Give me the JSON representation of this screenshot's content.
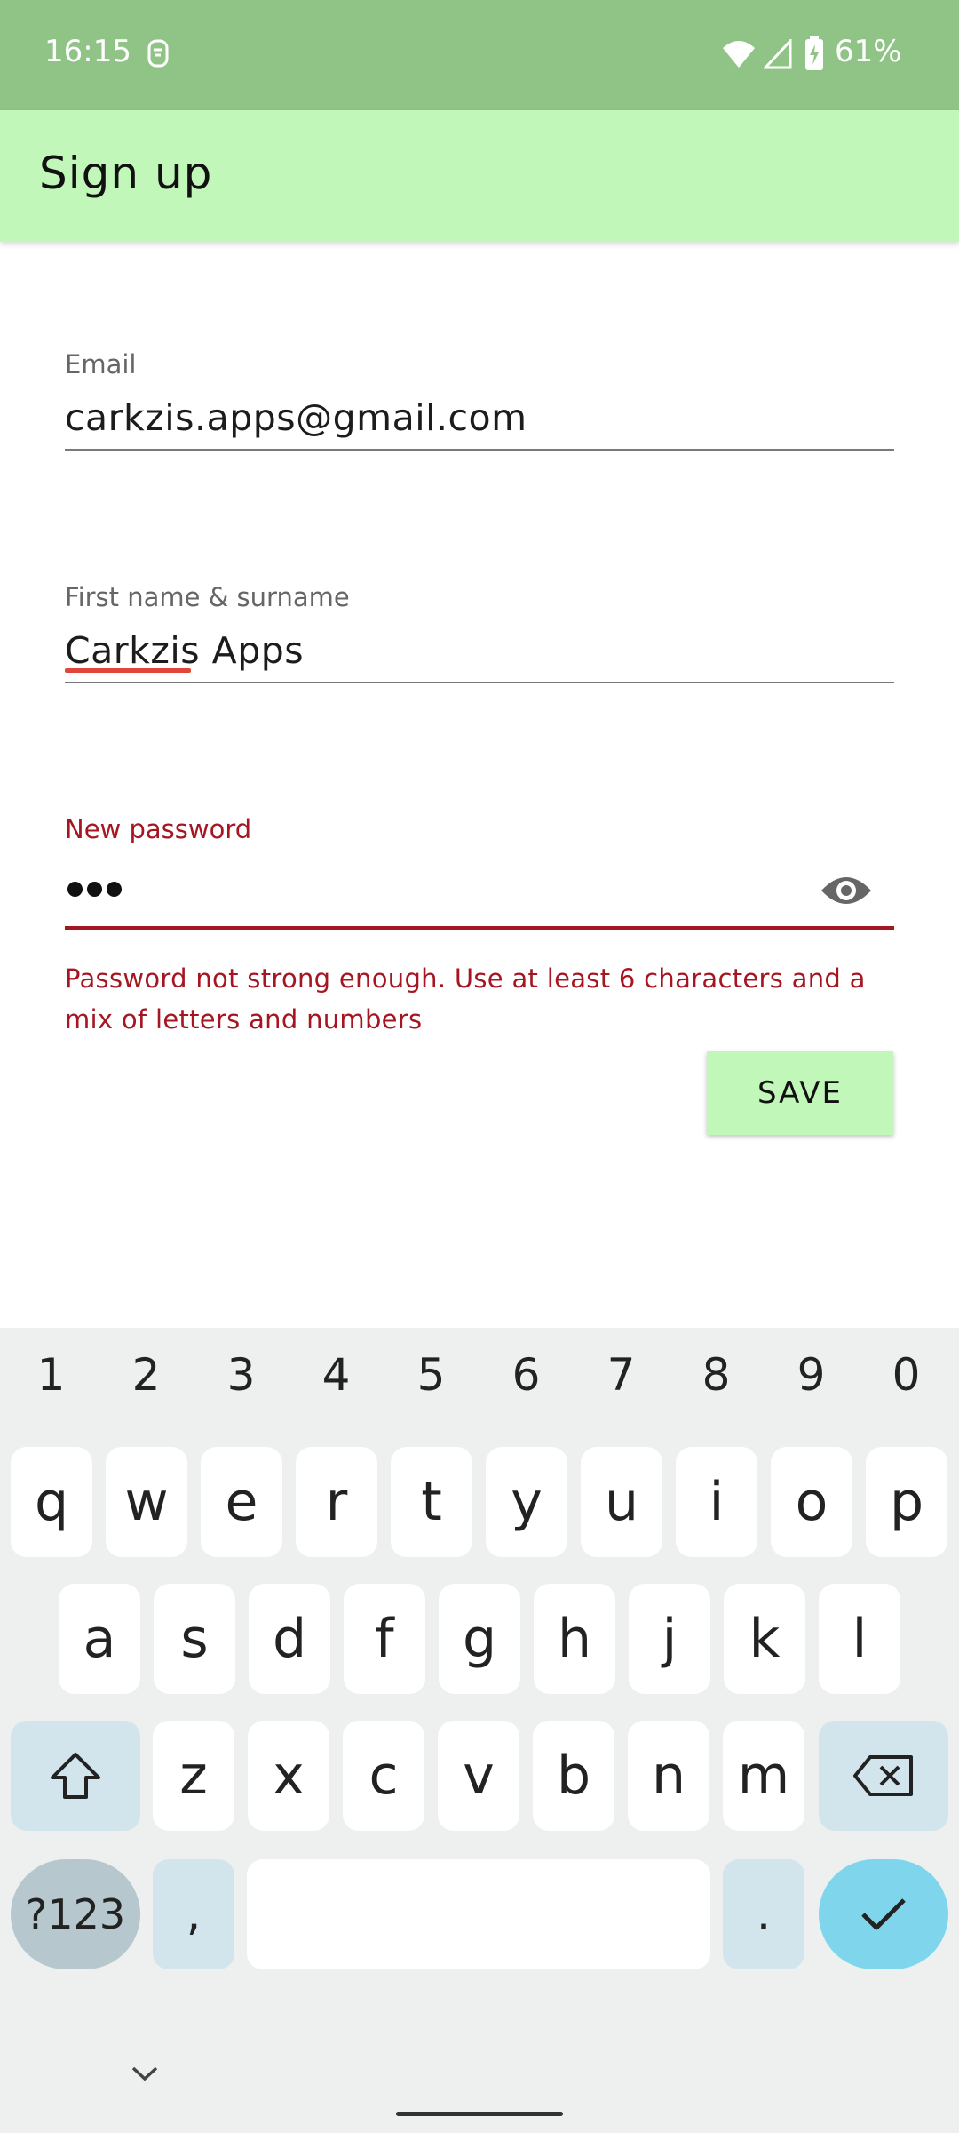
{
  "status_bar": {
    "time": "16:15",
    "battery_percent": "61%",
    "icons": [
      "notification-icon",
      "wifi-icon",
      "signal-icon",
      "battery-icon"
    ]
  },
  "app_bar": {
    "title": "Sign up"
  },
  "form": {
    "email": {
      "label": "Email",
      "value": "carkzis.apps@gmail.com"
    },
    "name": {
      "label": "First name & surname",
      "value": "Carkzis Apps"
    },
    "password": {
      "label": "New password",
      "value_masked_length": 3,
      "toggle_icon": "eye-icon",
      "error": "Password not strong enough. Use at least 6 characters and a mix of letters and numbers"
    },
    "save_label": "SAVE"
  },
  "keyboard": {
    "numbers": [
      "1",
      "2",
      "3",
      "4",
      "5",
      "6",
      "7",
      "8",
      "9",
      "0"
    ],
    "row1": [
      "q",
      "w",
      "e",
      "r",
      "t",
      "y",
      "u",
      "i",
      "o",
      "p"
    ],
    "row2": [
      "a",
      "s",
      "d",
      "f",
      "g",
      "h",
      "j",
      "k",
      "l"
    ],
    "row3": [
      "z",
      "x",
      "c",
      "v",
      "b",
      "n",
      "m"
    ],
    "symbols_label": "?123",
    "comma": ",",
    "period": ".",
    "space": "",
    "icons": [
      "shift-icon",
      "backspace-icon",
      "checkmark-icon",
      "chevron-down-icon"
    ]
  },
  "colors": {
    "status_bar": "#90c487",
    "app_bar": "#c1f7b9",
    "error": "#a51622",
    "enter_key": "#7fd6ec"
  }
}
